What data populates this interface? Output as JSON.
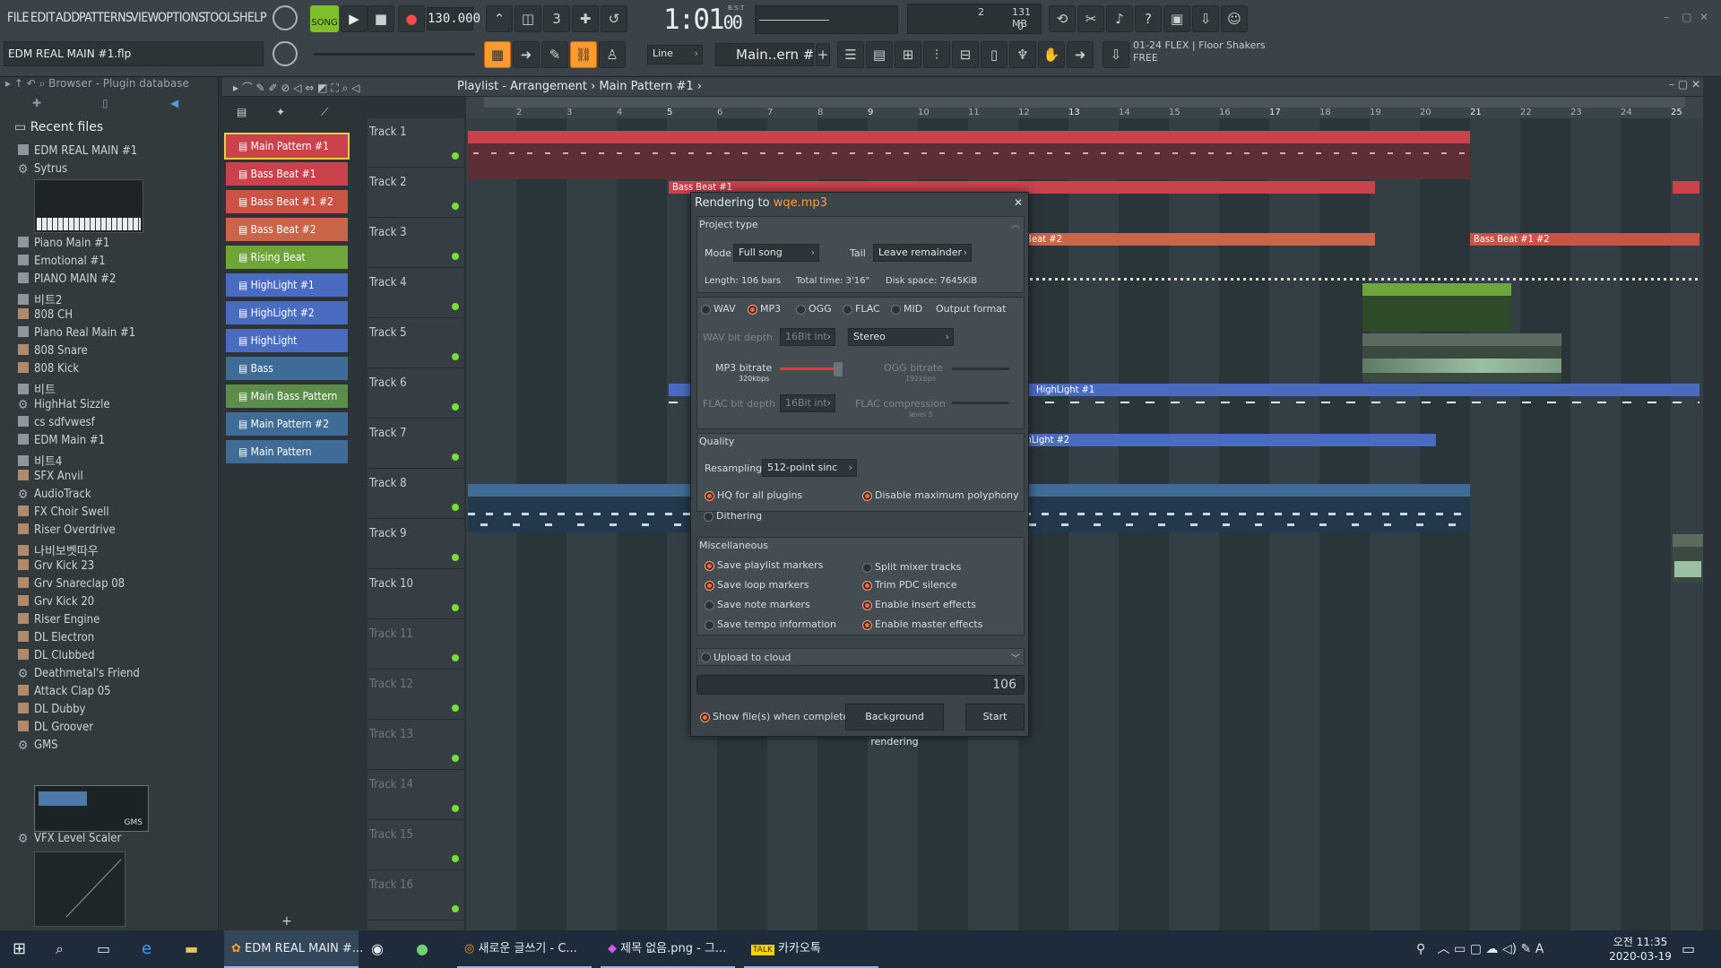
{
  "menu": [
    "FILE",
    "EDIT",
    "ADD",
    "PATTERNS",
    "VIEW",
    "OPTIONS",
    "TOOLS",
    "HELP"
  ],
  "transport": {
    "mode": "SONG",
    "tempo": "130.000",
    "time": "1:01",
    "time_sub": "00",
    "time_label": "B:S:T",
    "cpu_a": "2",
    "mem": "131 MB",
    "cpu_b": "0"
  },
  "project": {
    "file": "EDM REAL MAIN #1.flp",
    "pattern": "Main..ern #1",
    "snap": "Line",
    "hint_line1": "01-24  FLEX | Floor Shakers",
    "hint_line2": "FREE"
  },
  "browser": {
    "path": "Browser - Plugin database",
    "section": "Recent files",
    "items": [
      {
        "label": "EDM REAL MAIN #1",
        "icon": "file-icon"
      },
      {
        "label": "Sytrus",
        "icon": "gear-icon"
      },
      {
        "label": "Piano Main #1",
        "icon": "file-icon"
      },
      {
        "label": "Emotional #1",
        "icon": "file-icon"
      },
      {
        "label": "PIANO MAIN #2",
        "icon": "file-icon"
      },
      {
        "label": "비트2",
        "icon": "file-icon"
      },
      {
        "label": "808 CH",
        "icon": "audio-icon"
      },
      {
        "label": "Piano Real Main #1",
        "icon": "file-icon"
      },
      {
        "label": "808 Snare",
        "icon": "audio-icon"
      },
      {
        "label": "808 Kick",
        "icon": "audio-icon"
      },
      {
        "label": "비트",
        "icon": "file-icon"
      },
      {
        "label": "HighHat Sizzle",
        "icon": "gear-icon"
      },
      {
        "label": "cs sdfvwesf",
        "icon": "file-icon"
      },
      {
        "label": "EDM Main #1",
        "icon": "file-icon"
      },
      {
        "label": "비트4",
        "icon": "file-icon"
      },
      {
        "label": "SFX Anvil",
        "icon": "audio-icon"
      },
      {
        "label": "AudioTrack",
        "icon": "gear-icon"
      },
      {
        "label": "FX Choir Swell",
        "icon": "audio-icon"
      },
      {
        "label": "Riser Overdrive",
        "icon": "audio-icon"
      },
      {
        "label": "나비보벳따우",
        "icon": "audio-icon"
      },
      {
        "label": "Grv Kick 23",
        "icon": "audio-icon"
      },
      {
        "label": "Grv Snareclap 08",
        "icon": "audio-icon"
      },
      {
        "label": "Grv Kick 20",
        "icon": "audio-icon"
      },
      {
        "label": "Riser Engine",
        "icon": "audio-icon"
      },
      {
        "label": "DL Electron",
        "icon": "audio-icon"
      },
      {
        "label": "DL Clubbed",
        "icon": "audio-icon"
      },
      {
        "label": "Deathmetal's Friend",
        "icon": "gear-icon"
      },
      {
        "label": "Attack Clap 05",
        "icon": "audio-icon"
      },
      {
        "label": "DL Dubby",
        "icon": "audio-icon"
      },
      {
        "label": "DL Groover",
        "icon": "audio-icon"
      },
      {
        "label": "GMS",
        "icon": "gear-icon"
      },
      {
        "label": "VFX Level Scaler",
        "icon": "gear-icon"
      }
    ]
  },
  "playlist": {
    "title": "Playlist - Arrangement",
    "pattern": "Main Pattern #1",
    "ruler": [
      "2",
      "3",
      "4",
      "5",
      "6",
      "7",
      "8",
      "9",
      "10",
      "11",
      "12",
      "13",
      "14",
      "15",
      "16",
      "17",
      "18",
      "19",
      "20",
      "21",
      "22",
      "23",
      "24",
      "25"
    ],
    "patterns": [
      {
        "label": "Main Pattern #1",
        "color": "#c9424c"
      },
      {
        "label": "Bass Beat #1",
        "color": "#c9424c"
      },
      {
        "label": "Bass Beat #1 #2",
        "color": "#c95446"
      },
      {
        "label": "Bass Beat #2",
        "color": "#c9664a"
      },
      {
        "label": "Rising Beat",
        "color": "#6fa63a"
      },
      {
        "label": "HighLight #1",
        "color": "#4a6cc0"
      },
      {
        "label": "HighLight #2",
        "color": "#4a6cc0"
      },
      {
        "label": "HighLight",
        "color": "#4a6cc0"
      },
      {
        "label": "Bass",
        "color": "#3f6c96"
      },
      {
        "label": "Main Bass Pattern",
        "color": "#5c8d4a"
      },
      {
        "label": "Main Pattern #2",
        "color": "#3f6c96"
      },
      {
        "label": "Main Pattern",
        "color": "#3f6c96"
      }
    ],
    "tracks": [
      "Track 1",
      "Track 2",
      "Track 3",
      "Track 4",
      "Track 5",
      "Track 6",
      "Track 7",
      "Track 8",
      "Track 9",
      "Track 10",
      "Track 11",
      "Track 12",
      "Track 13",
      "Track 14",
      "Track 15",
      "Track 16"
    ]
  },
  "render": {
    "title_prefix": "Rendering to ",
    "title_file": "wqe.mp3",
    "project_type": "Project type",
    "mode_label": "Mode",
    "mode": "Full song",
    "tail_label": "Tail",
    "tail": "Leave remainder",
    "length": "Length: 106 bars",
    "total_time": "Total time: 3'16\"",
    "disk_space": "Disk space: 7645KiB",
    "formats": [
      "WAV",
      "MP3",
      "OGG",
      "FLAC",
      "MID"
    ],
    "output_format": "Output format",
    "wav_bit_depth_label": "WAV bit depth",
    "wav_bit_depth": "16Bit int",
    "channels": "Stereo",
    "mp3_bitrate_label": "MP3 bitrate",
    "mp3_bitrate": "320kbps",
    "mp3_level": 1.0,
    "ogg_bitrate_label": "OGG bitrate",
    "ogg_bitrate": "192kbps",
    "flac_bit_depth_label": "FLAC bit depth",
    "flac_bit_depth": "16Bit int",
    "flac_compression_label": "FLAC compression",
    "flac_level": "level 5",
    "quality": "Quality",
    "resampling_label": "Resampling",
    "resampling": "512-point sinc",
    "hq_plugins": "HQ for all plugins",
    "disable_polyphony": "Disable maximum polyphony",
    "dithering": "Dithering",
    "misc": "Miscellaneous",
    "misc_left": [
      "Save playlist markers",
      "Save loop markers",
      "Save note markers",
      "Save tempo information"
    ],
    "misc_right": [
      "Split mixer tracks",
      "Trim PDC silence",
      "Enable insert effects",
      "Enable master effects"
    ],
    "upload": "Upload to cloud",
    "progress": "106",
    "show_files": "Show file(s) when complete",
    "background_btn": "Background rendering",
    "start_btn": "Start"
  },
  "taskbar": {
    "apps": [
      "EDM REAL MAIN #...",
      "새로운 글쓰기 - C...",
      "제목 없음.png - 그...",
      "카카오톡"
    ],
    "clock": "오전 11:35",
    "date": "2020-03-19",
    "ime": "A"
  }
}
